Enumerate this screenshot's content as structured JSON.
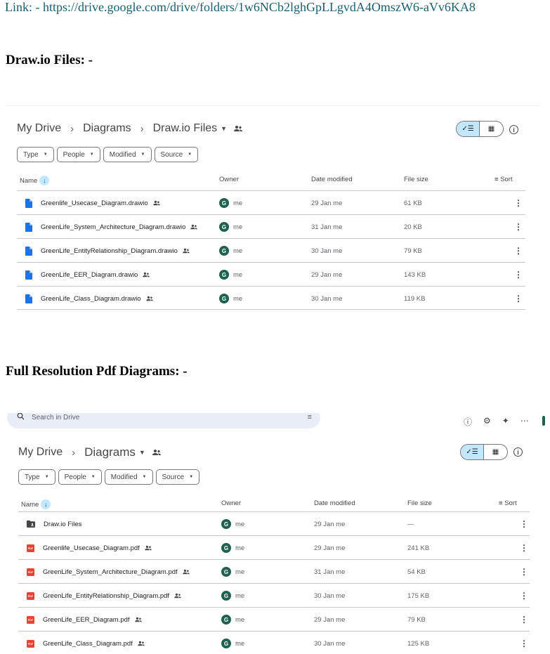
{
  "doc": {
    "link_text": "Link: - https://drive.google.com/drive/folders/1w6NCb2lghGpLLgvdA4OmszW6-aVv6KA8",
    "heading1": "Draw.io Files: -",
    "heading2": "Full Resolution Pdf Diagrams: -"
  },
  "colors": {
    "accent": "#c2e7ff",
    "drawio_icon": "#1a73e8",
    "pdf_icon": "#ea4335",
    "avatar": "#1e6151"
  },
  "panel1": {
    "breadcrumb": {
      "root": "My Drive",
      "mid": "Diagrams",
      "current": "Draw.io Files"
    },
    "filters": [
      "Type",
      "People",
      "Modified",
      "Source"
    ],
    "columns": {
      "name": "Name",
      "owner": "Owner",
      "date": "Date modified",
      "size": "File size",
      "sort": "Sort"
    },
    "rows": [
      {
        "icon": "drawio-file-icon",
        "name": "Greenlife_Usecase_Diagram.drawio",
        "avatar": "G",
        "owner": "me",
        "date": "29 Jan me",
        "size": "61 KB"
      },
      {
        "icon": "drawio-file-icon",
        "name": "GreenLife_System_Architecture_Diagram.drawio",
        "avatar": "G",
        "owner": "me",
        "date": "31 Jan me",
        "size": "20 KB"
      },
      {
        "icon": "drawio-file-icon",
        "name": "GreenLife_EntityRelationship_Diagram.drawio",
        "avatar": "G",
        "owner": "me",
        "date": "30 Jan me",
        "size": "79 KB"
      },
      {
        "icon": "drawio-file-icon",
        "name": "GreenLife_EER_Diagram.drawio",
        "avatar": "G",
        "owner": "me",
        "date": "29 Jan me",
        "size": "143 KB"
      },
      {
        "icon": "drawio-file-icon",
        "name": "GreenLife_Class_Diagram.drawio",
        "avatar": "G",
        "owner": "me",
        "date": "30 Jan me",
        "size": "119 KB"
      }
    ]
  },
  "panel2": {
    "search_placeholder": "Search in Drive",
    "breadcrumb": {
      "root": "My Drive",
      "current": "Diagrams"
    },
    "filters": [
      "Type",
      "People",
      "Modified",
      "Source"
    ],
    "columns": {
      "name": "Name",
      "owner": "Owner",
      "date": "Date modified",
      "size": "File size",
      "sort": "Sort"
    },
    "rows": [
      {
        "icon": "folder-shared-icon",
        "name": "Draw.io Files",
        "avatar": "G",
        "owner": "me",
        "date": "29 Jan me",
        "size": "—"
      },
      {
        "icon": "pdf-file-icon",
        "name": "Greenlife_Usecase_Diagram.pdf",
        "avatar": "G",
        "owner": "me",
        "date": "29 Jan me",
        "size": "241 KB"
      },
      {
        "icon": "pdf-file-icon",
        "name": "GreenLife_System_Architecture_Diagram.pdf",
        "avatar": "G",
        "owner": "me",
        "date": "31 Jan me",
        "size": "54 KB"
      },
      {
        "icon": "pdf-file-icon",
        "name": "GreenLife_EntityRelationship_Diagram.pdf",
        "avatar": "G",
        "owner": "me",
        "date": "30 Jan me",
        "size": "175 KB"
      },
      {
        "icon": "pdf-file-icon",
        "name": "GreenLife_EER_Diagram.pdf",
        "avatar": "G",
        "owner": "me",
        "date": "29 Jan me",
        "size": "79 KB"
      },
      {
        "icon": "pdf-file-icon",
        "name": "GreenLife_Class_Diagram.pdf",
        "avatar": "G",
        "owner": "me",
        "date": "30 Jan me",
        "size": "125 KB"
      }
    ]
  }
}
